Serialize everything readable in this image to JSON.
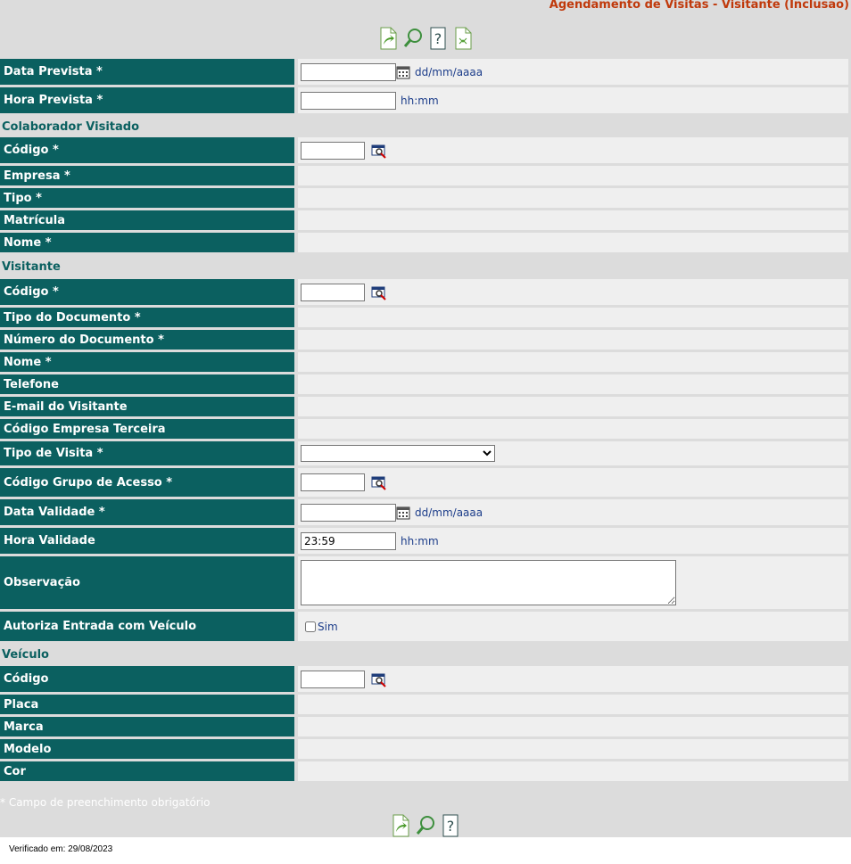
{
  "header": {
    "title": "Agendamento de Visitas - Visitante (Inclusão)"
  },
  "toolbar": {
    "icons": [
      "save-icon",
      "search-icon",
      "help-icon",
      "clear-icon"
    ]
  },
  "fields": {
    "data_prevista": {
      "label": "Data Prevista *",
      "value": "",
      "hint": "dd/mm/aaaa"
    },
    "hora_prevista": {
      "label": "Hora Prevista *",
      "value": "",
      "hint": "hh:mm"
    }
  },
  "colaborador": {
    "section_title": "Colaborador Visitado",
    "codigo_label": "Código *",
    "codigo_value": "",
    "empresa_label": "Empresa *",
    "tipo_label": "Tipo *",
    "matricula_label": "Matrícula",
    "nome_label": "Nome *"
  },
  "visitante": {
    "section_title": "Visitante",
    "codigo_label": "Código *",
    "codigo_value": "",
    "tipo_documento_label": "Tipo do Documento *",
    "numero_documento_label": "Número do Documento *",
    "nome_label": "Nome *",
    "telefone_label": "Telefone",
    "email_label": "E-mail do Visitante",
    "empresa_terceira_label": "Código Empresa Terceira",
    "tipo_visita_label": "Tipo de Visita *",
    "tipo_visita_selected": "",
    "grupo_acesso_label": "Código Grupo de Acesso *",
    "grupo_acesso_value": "",
    "data_validade_label": "Data Validade *",
    "data_validade_value": "",
    "data_validade_hint": "dd/mm/aaaa",
    "hora_validade_label": "Hora Validade",
    "hora_validade_value": "23:59",
    "hora_validade_hint": "hh:mm",
    "observacao_label": "Observação",
    "observacao_value": "",
    "autoriza_label": "Autoriza Entrada com Veículo",
    "autoriza_checkbox_label": "Sim"
  },
  "veiculo": {
    "section_title": "Veículo",
    "codigo_label": "Código",
    "codigo_value": "",
    "placa_label": "Placa",
    "marca_label": "Marca",
    "modelo_label": "Modelo",
    "cor_label": "Cor"
  },
  "footer": {
    "required_note": "* Campo de preenchimento obrigatório",
    "verified": "Verificado em: 29/08/2023"
  }
}
